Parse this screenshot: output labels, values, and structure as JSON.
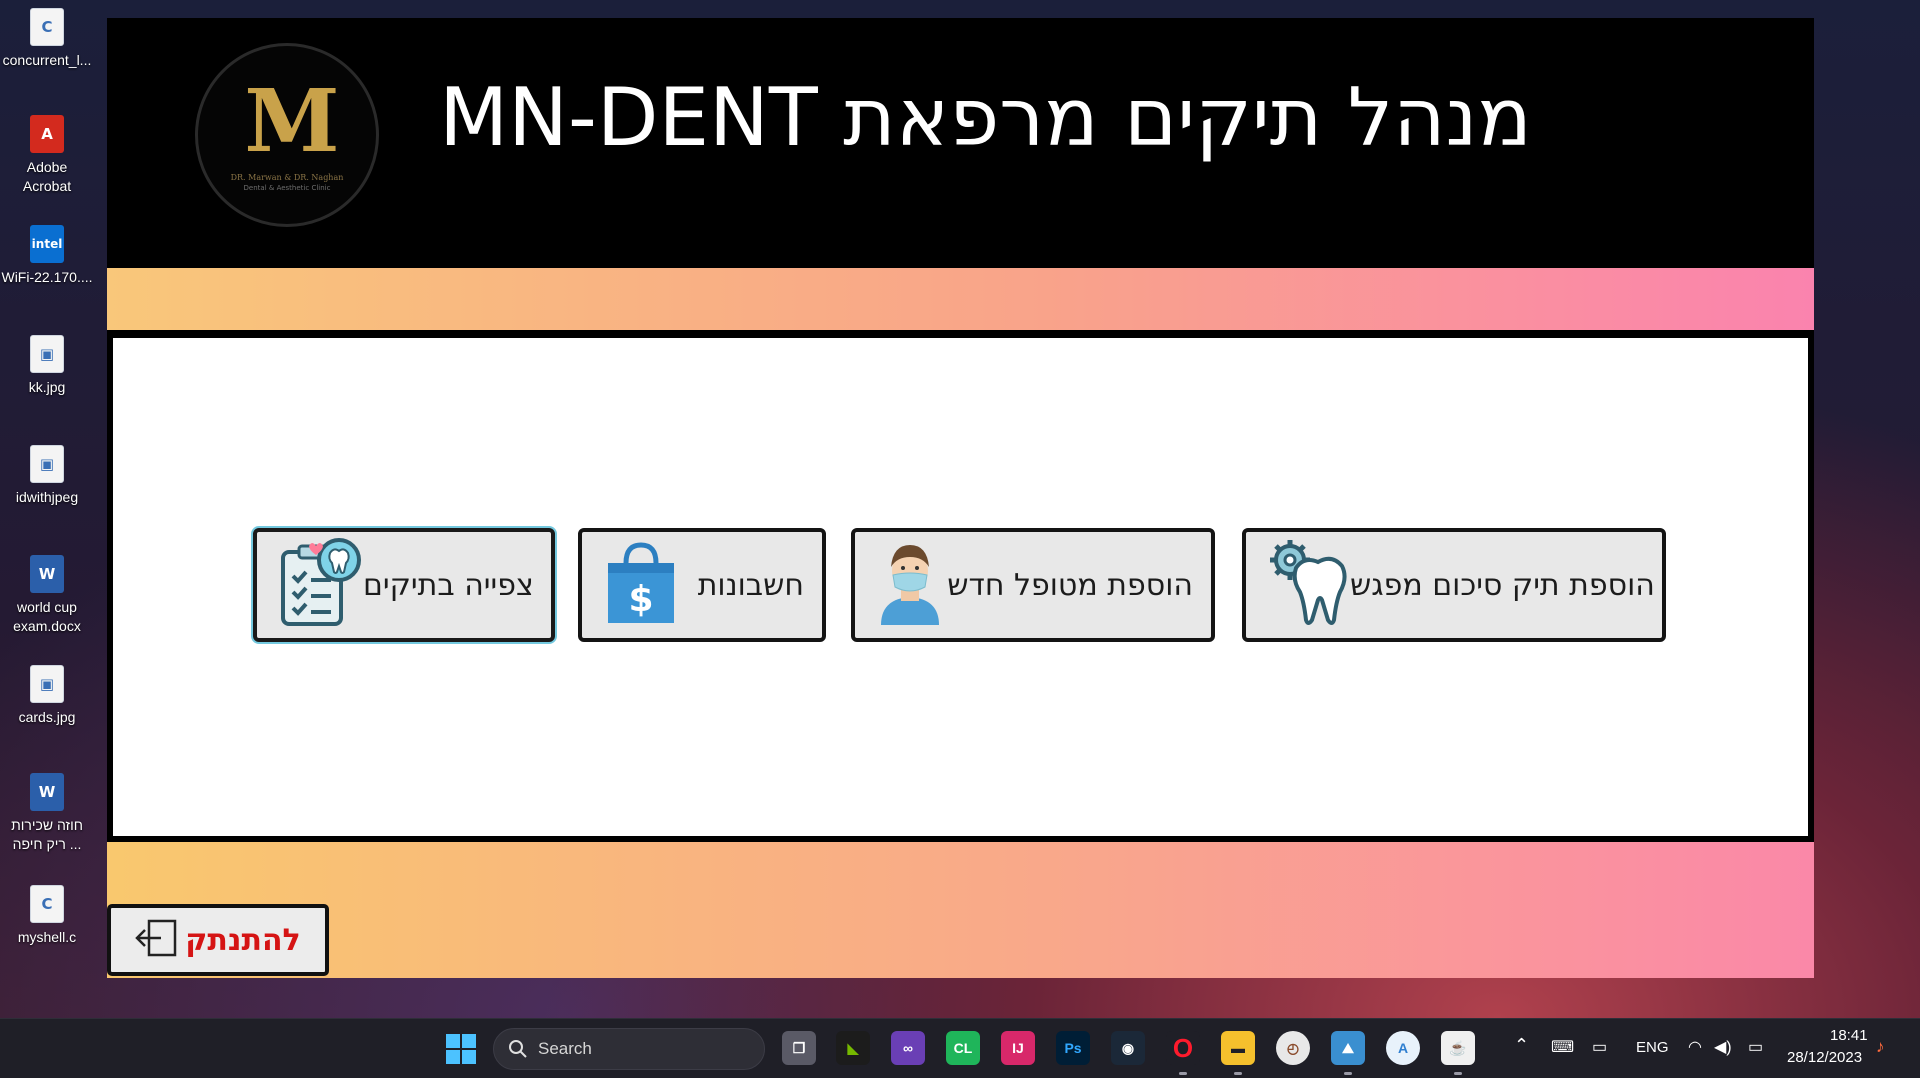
{
  "desktop": {
    "icons": [
      {
        "label": "concurrent_l...",
        "icon": "c-source-file-icon"
      },
      {
        "label": "Adobe Acrobat",
        "icon": "acrobat-icon"
      },
      {
        "label": "WiFi-22.170....",
        "icon": "intel-wifi-icon"
      },
      {
        "label": "kk.jpg",
        "icon": "image-file-icon"
      },
      {
        "label": "idwithjpeg",
        "icon": "image-file-icon"
      },
      {
        "label": "world cup exam.docx",
        "icon": "word-document-icon"
      },
      {
        "label": "cards.jpg",
        "icon": "image-file-icon"
      },
      {
        "label": "חוזה שכירות ריק חיפה ...",
        "icon": "word-document-icon"
      },
      {
        "label": "myshell.c",
        "icon": "c-source-file-icon"
      }
    ]
  },
  "app": {
    "title": "מנהל תיקים מרפאת MN-DENT",
    "logo": {
      "mark": "M",
      "subtitle": "DR. Marwan & DR. Naghan",
      "caption": "Dental & Aesthetic Clinic"
    },
    "buttons": {
      "view_files": "צפייה בתיקים",
      "accounts": "חשבונות",
      "add_patient": "הוספת מטופל חדש",
      "add_summary": "הוספת תיק סיכום מפגש"
    },
    "logout": "להתנתק",
    "colors": {
      "band_start": "#f9c77a",
      "band_end": "#fa83ae",
      "logout_text": "#d51414",
      "logo_gold": "#c9a24a"
    }
  },
  "taskbar": {
    "search_label": "Search",
    "language": "ENG",
    "time": "18:41",
    "date": "28/12/2023"
  }
}
